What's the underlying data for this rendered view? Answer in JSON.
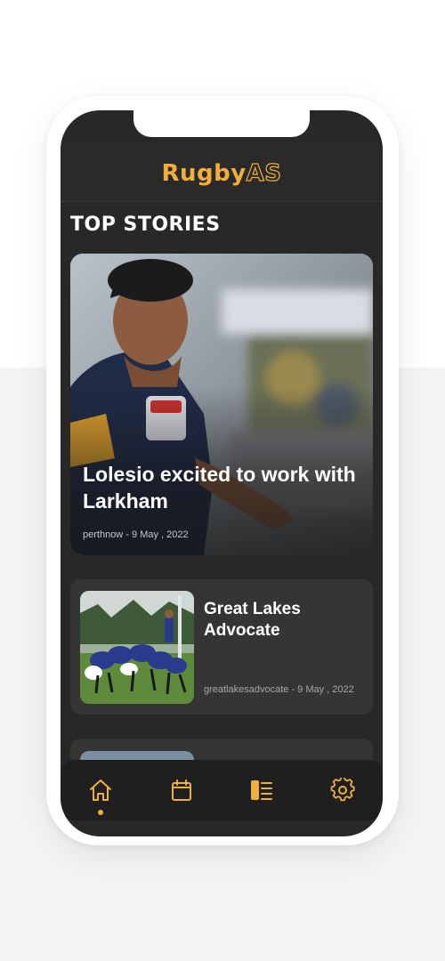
{
  "app": {
    "logo_main": "Rugby",
    "logo_accent": "AS",
    "accent_color": "#f0ae3a"
  },
  "section": {
    "title": "TOP STORIES"
  },
  "stories": [
    {
      "title": "Lolesio excited to work with Larkham",
      "source": "perthnow",
      "date": "9 May , 2022",
      "meta": "perthnow - 9 May , 2022",
      "image": "rugby-player-photo"
    },
    {
      "title": "Great Lakes Advocate",
      "source": "greatlakesadvocate",
      "date": "9 May , 2022",
      "meta": "greatlakesadvocate - 9 May , 2022",
      "image": "rugby-scrum-photo"
    }
  ],
  "nav": {
    "items": [
      {
        "icon": "home-icon",
        "active": true
      },
      {
        "icon": "calendar-icon",
        "active": false
      },
      {
        "icon": "list-icon",
        "active": false
      },
      {
        "icon": "gear-icon",
        "active": false
      }
    ]
  }
}
